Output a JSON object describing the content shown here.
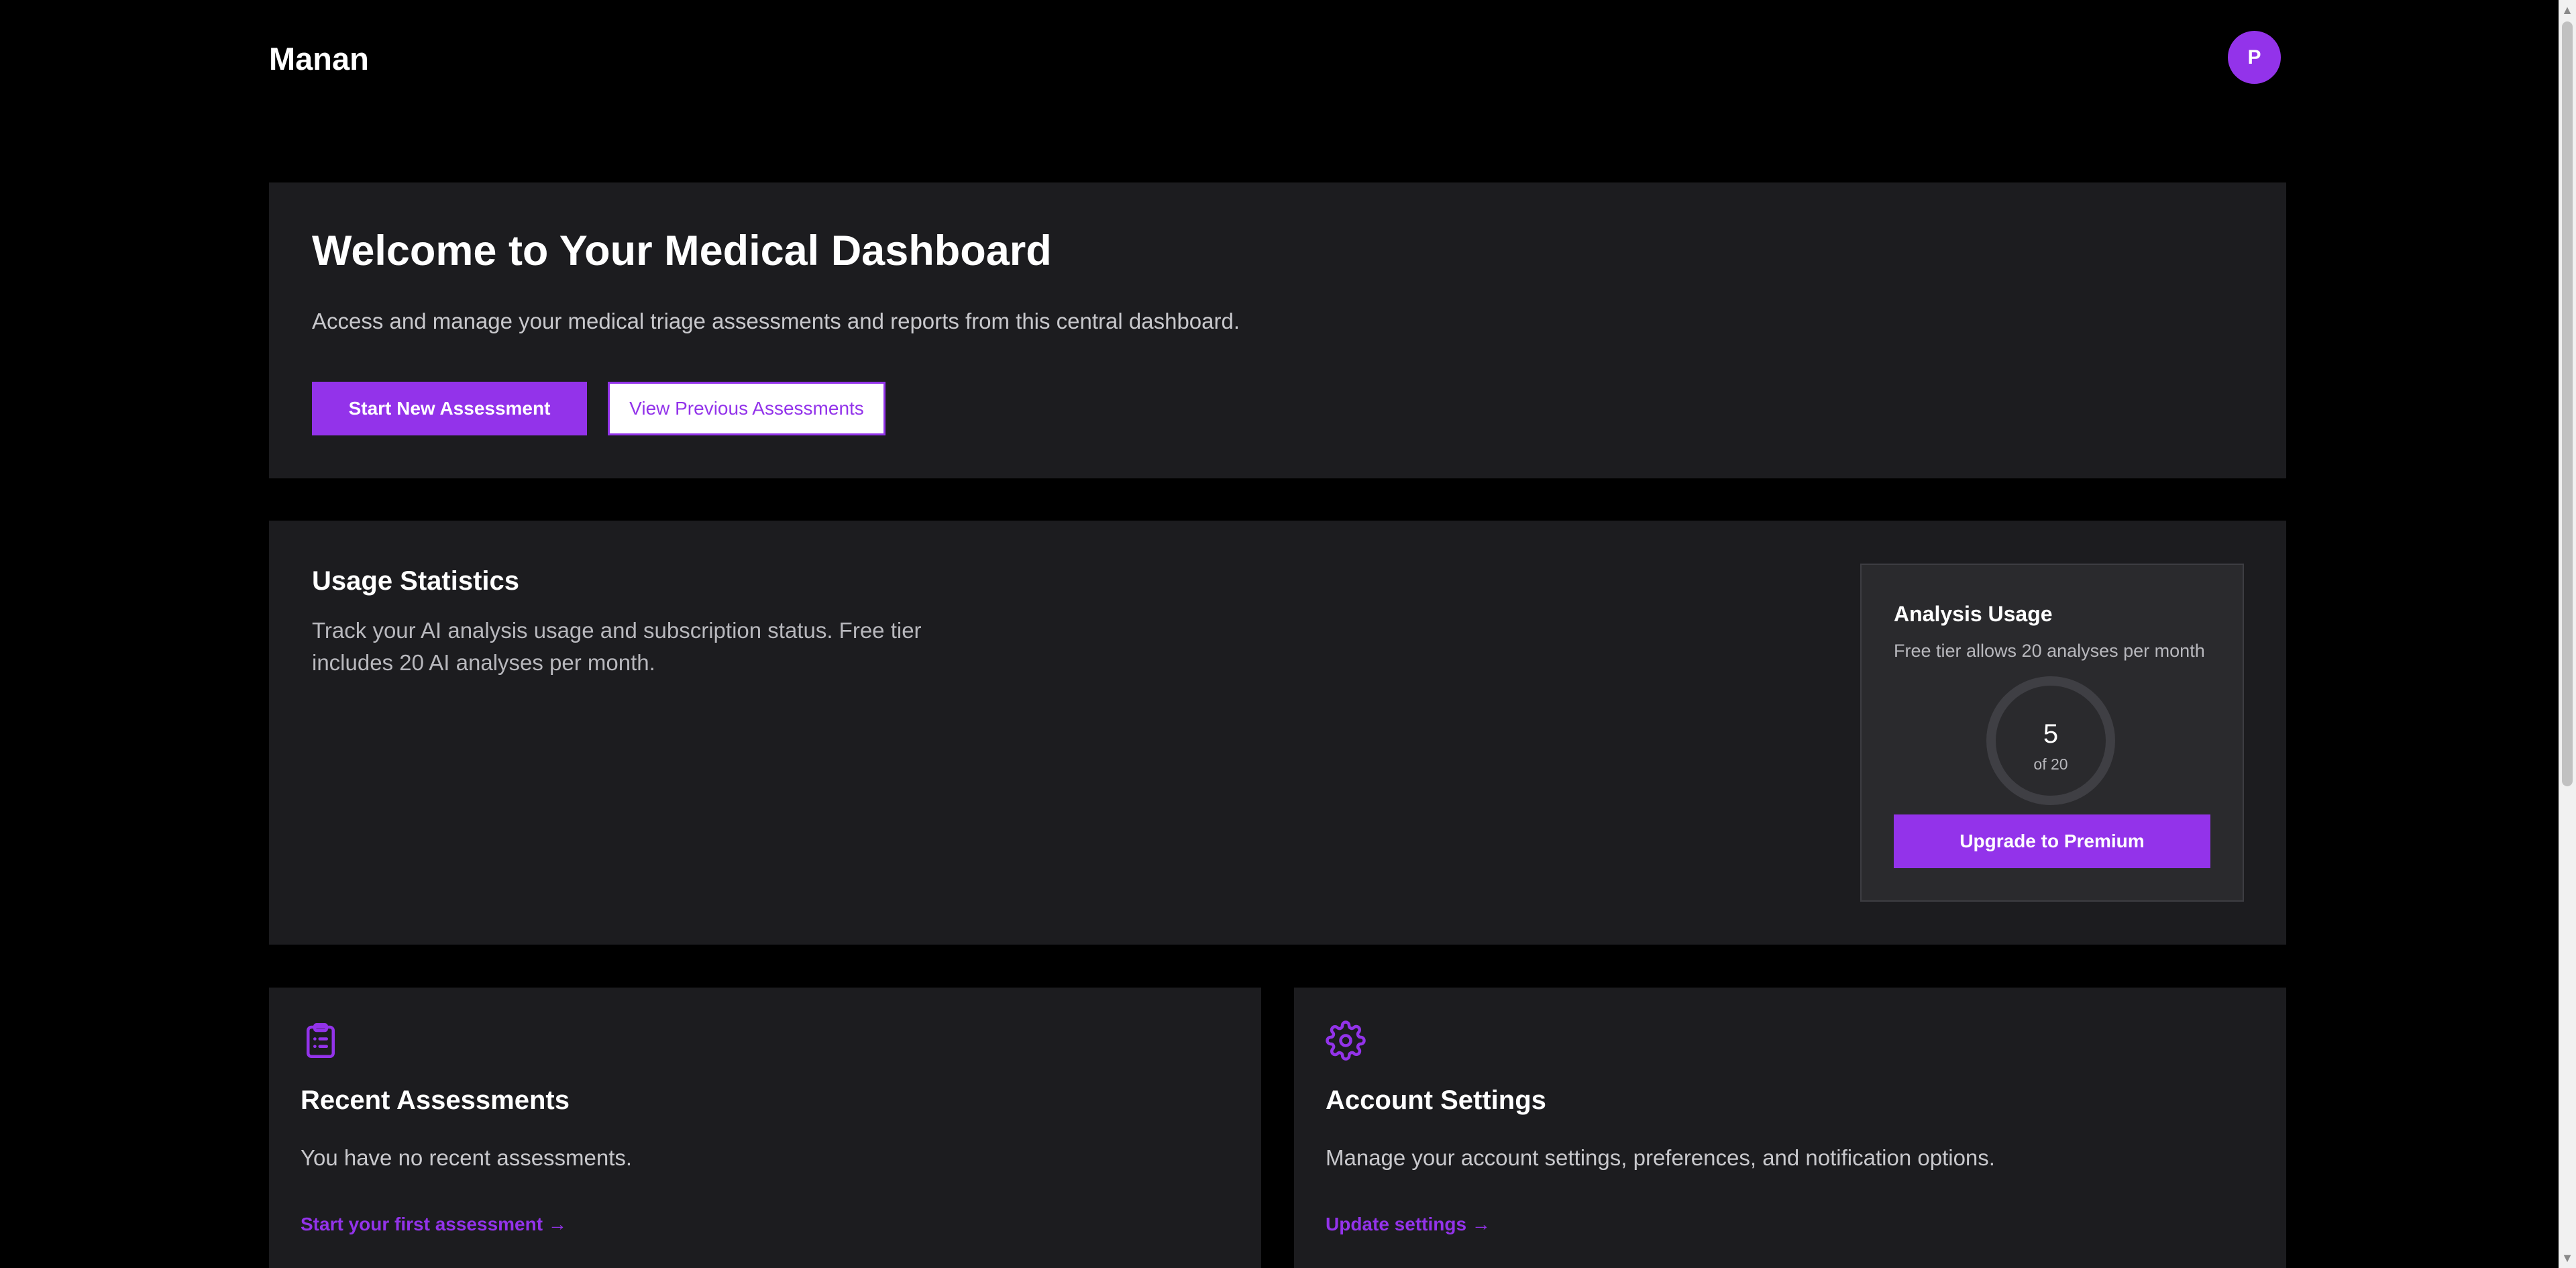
{
  "header": {
    "brand": "Manan",
    "avatar_initial": "P"
  },
  "welcome": {
    "title": "Welcome to Your Medical Dashboard",
    "description": "Access and manage your medical triage assessments and reports from this central dashboard.",
    "primary_button": "Start New Assessment",
    "secondary_button": "View Previous Assessments"
  },
  "usage": {
    "title": "Usage Statistics",
    "description": "Track your AI analysis usage and subscription status. Free tier includes 20 AI analyses per month.",
    "panel": {
      "title": "Analysis Usage",
      "subtitle": "Free tier allows 20 analyses per month",
      "used": "5",
      "of_label": "of 20",
      "upgrade_button": "Upgrade to Premium"
    }
  },
  "recent": {
    "icon": "clipboard-list-icon",
    "title": "Recent Assessments",
    "description": "You have no recent assessments.",
    "link": "Start your first assessment →"
  },
  "settings": {
    "icon": "gear-icon",
    "title": "Account Settings",
    "description": "Manage your account settings, preferences, and notification options.",
    "link": "Update settings →"
  },
  "colors": {
    "accent": "#9333ea",
    "background": "#000000",
    "card": "#1c1c1f"
  }
}
